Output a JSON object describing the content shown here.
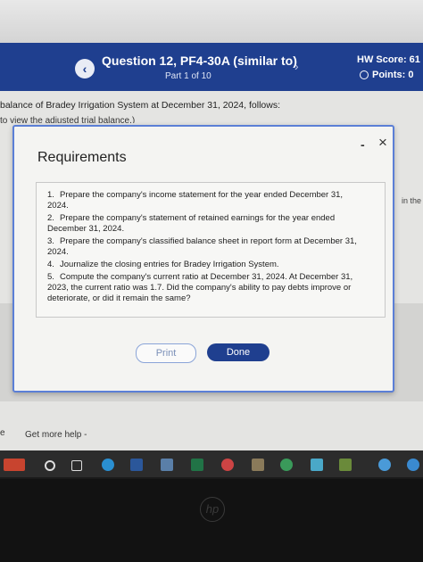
{
  "header": {
    "back": "‹",
    "title": "Question 12, PF4-30A (similar to)",
    "part": "Part 1 of 10",
    "next": "›",
    "hw_score": "HW Score: 61",
    "points": "Points: 0"
  },
  "content": {
    "intro": "balance of Bradey Irrigation System at December 31, 2024, follows:",
    "link": "to view the adjusted trial balance.)",
    "side_text": "in the",
    "help": "Get more help -",
    "left_e": "e"
  },
  "modal": {
    "title": "Requirements",
    "minimize": "-",
    "close": "×",
    "requirements": [
      {
        "num": "1.",
        "text": "Prepare the company's income statement for the year ended December 31, 2024."
      },
      {
        "num": "2.",
        "text": "Prepare the company's statement of retained earnings for the year ended December 31, 2024."
      },
      {
        "num": "3.",
        "text": "Prepare the company's classified balance sheet in report form at December 31, 2024."
      },
      {
        "num": "4.",
        "text": "Journalize the closing entries for Bradey Irrigation System."
      },
      {
        "num": "5.",
        "text": "Compute the company's current ratio at December 31, 2024. At December 31, 2023, the current ratio was 1.7. Did the company's ability to pay debts improve or deteriorate, or did it remain the same?"
      }
    ],
    "print_label": "Print",
    "done_label": "Done"
  },
  "bezel": {
    "logo": "hp"
  }
}
